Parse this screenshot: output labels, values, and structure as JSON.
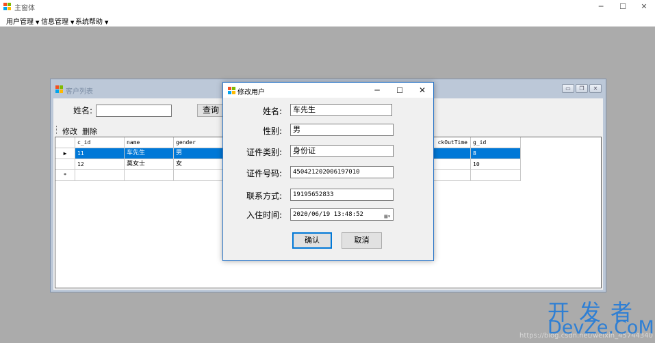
{
  "window": {
    "title": "主窗体",
    "minimize": "─",
    "maximize": "☐",
    "close": "✕"
  },
  "menu": [
    {
      "label": "用户管理"
    },
    {
      "label": "信息管理"
    },
    {
      "label": "系统帮助"
    }
  ],
  "child_window": {
    "title": "客户列表",
    "name_label": "姓名:",
    "name_value": "",
    "query_button": "查询",
    "toolbar": {
      "edit": "修改",
      "delete": "删除"
    },
    "grid": {
      "columns": [
        "c_id",
        "name",
        "gender",
        "ckOutTime",
        "g_id"
      ],
      "rows": [
        {
          "marker": "▶",
          "c_id": "11",
          "name": "车先生",
          "gender": "男",
          "ckOutTime": "",
          "g_id": "8"
        },
        {
          "marker": "",
          "c_id": "12",
          "name": "莫女士",
          "gender": "女",
          "ckOutTime": "",
          "g_id": "10"
        },
        {
          "marker": "*",
          "c_id": "",
          "name": "",
          "gender": "",
          "ckOutTime": "",
          "g_id": ""
        }
      ]
    }
  },
  "dialog": {
    "title": "修改用户",
    "fields": [
      {
        "label": "姓名:",
        "value": "车先生"
      },
      {
        "label": "性别:",
        "value": "男"
      },
      {
        "label": "证件类别:",
        "value": "身份证"
      },
      {
        "label": "证件号码:",
        "value": "450421202006197010"
      },
      {
        "label": "联系方式:",
        "value": "19195652833"
      },
      {
        "label": "入住时间:",
        "value": "2020/06/19 13:48:52"
      }
    ],
    "ok_button": "确认",
    "cancel_button": "取消"
  },
  "watermark": {
    "cn": "开发者",
    "en": "DevZe.CoM",
    "url": "https://blog.csdn.net/weixin_45744340"
  },
  "colors": {
    "selection": "#0078d7",
    "mdi_background": "#ababab",
    "watermark": "#2e7fd4"
  }
}
